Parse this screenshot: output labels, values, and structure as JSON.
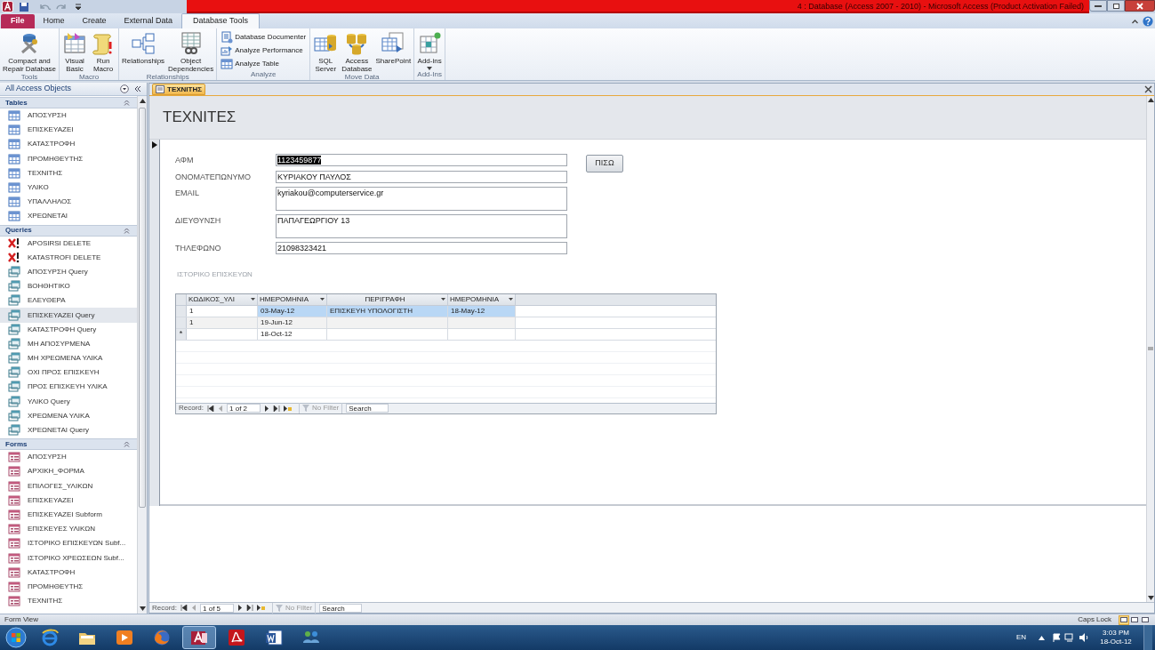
{
  "window": {
    "title": "4 : Database (Access 2007 - 2010)  -  Microsoft Access (Product Activation Failed)"
  },
  "ribbon_tabs": [
    {
      "label": "File",
      "kind": "file",
      "selected": false
    },
    {
      "label": "Home",
      "kind": "tab",
      "selected": false
    },
    {
      "label": "Create",
      "kind": "tab",
      "selected": false
    },
    {
      "label": "External Data",
      "kind": "tab",
      "selected": false
    },
    {
      "label": "Database Tools",
      "kind": "tab",
      "selected": true
    }
  ],
  "ribbon_groups": [
    {
      "label": "Tools",
      "buttons": [
        {
          "label": "Compact and\nRepair Database",
          "kind": "large"
        }
      ]
    },
    {
      "label": "Macro",
      "buttons": [
        {
          "label": "Visual\nBasic",
          "kind": "large"
        },
        {
          "label": "Run\nMacro",
          "kind": "large"
        }
      ]
    },
    {
      "label": "Relationships",
      "buttons": [
        {
          "label": "Relationships",
          "kind": "large"
        },
        {
          "label": "Object\nDependencies",
          "kind": "large"
        }
      ]
    },
    {
      "label": "Analyze",
      "buttons": [
        {
          "label": "Database Documenter",
          "kind": "small"
        },
        {
          "label": "Analyze Performance",
          "kind": "small"
        },
        {
          "label": "Analyze Table",
          "kind": "small"
        }
      ]
    },
    {
      "label": "Move Data",
      "buttons": [
        {
          "label": "SQL\nServer",
          "kind": "large"
        },
        {
          "label": "Access\nDatabase",
          "kind": "large"
        },
        {
          "label": "SharePoint",
          "kind": "large"
        }
      ]
    },
    {
      "label": "Add-Ins",
      "buttons": [
        {
          "label": "Add-ins",
          "kind": "dropdown"
        }
      ]
    }
  ],
  "navigation": {
    "header": "All Access Objects",
    "groups": [
      {
        "label": "Tables",
        "items": [
          {
            "label": "ΑΠΟΣΥΡΣΗ",
            "kind": "table",
            "selected": false
          },
          {
            "label": "ΕΠΙΣΚΕΥΑΖΕΙ",
            "kind": "table",
            "selected": false
          },
          {
            "label": "ΚΑΤΑΣΤΡΟΦΗ",
            "kind": "table",
            "selected": false
          },
          {
            "label": "ΠΡΟΜΗΘΕΥΤΗΣ",
            "kind": "table",
            "selected": false
          },
          {
            "label": "ΤΕΧΝΙΤΗΣ",
            "kind": "table",
            "selected": false
          },
          {
            "label": "ΥΛΙΚΟ",
            "kind": "table",
            "selected": false
          },
          {
            "label": "ΥΠΑΛΛΗΛΟΣ",
            "kind": "table",
            "selected": false
          },
          {
            "label": "ΧΡΕΩΝΕΤΑΙ",
            "kind": "table",
            "selected": false
          }
        ]
      },
      {
        "label": "Queries",
        "items": [
          {
            "label": "APOSIRSI DELETE",
            "kind": "delete_query",
            "selected": false
          },
          {
            "label": "KATASTROFI DELETE",
            "kind": "delete_query",
            "selected": false
          },
          {
            "label": "ΑΠΟΣΥΡΣΗ Query",
            "kind": "query",
            "selected": false
          },
          {
            "label": "ΒΟΗΘΗΤΙΚΟ",
            "kind": "query",
            "selected": false
          },
          {
            "label": "ΕΛΕΥΘΕΡΑ",
            "kind": "query",
            "selected": false
          },
          {
            "label": "ΕΠΙΣΚΕΥΑΖΕΙ Query",
            "kind": "query",
            "selected": true
          },
          {
            "label": "ΚΑΤΑΣΤΡΟΦΗ Query",
            "kind": "query",
            "selected": false
          },
          {
            "label": "ΜΗ ΑΠΟΣΥΡΜΕΝΑ",
            "kind": "query",
            "selected": false
          },
          {
            "label": "ΜΗ ΧΡΕΩΜΕΝΑ ΥΛΙΚΑ",
            "kind": "query",
            "selected": false
          },
          {
            "label": "ΟΧΙ ΠΡΟΣ ΕΠΙΣΚΕΥΗ",
            "kind": "query",
            "selected": false
          },
          {
            "label": "ΠΡΟΣ ΕΠΙΣΚΕΥΗ ΥΛΙΚΑ",
            "kind": "query",
            "selected": false
          },
          {
            "label": "ΥΛΙΚΟ Query",
            "kind": "query",
            "selected": false
          },
          {
            "label": "ΧΡΕΩΜΕΝΑ ΥΛΙΚΑ",
            "kind": "query",
            "selected": false
          },
          {
            "label": "ΧΡΕΩΝΕΤΑΙ Query",
            "kind": "query",
            "selected": false
          }
        ]
      },
      {
        "label": "Forms",
        "items": [
          {
            "label": "ΑΠΟΣΥΡΣΗ",
            "kind": "form",
            "selected": false
          },
          {
            "label": "ΑΡΧΙΚΗ_ΦΟΡΜΑ",
            "kind": "form",
            "selected": false
          },
          {
            "label": "ΕΠΙΛΟΓΕΣ_ΥΛΙΚΩΝ",
            "kind": "form",
            "selected": false
          },
          {
            "label": "ΕΠΙΣΚΕΥΑΖΕΙ",
            "kind": "form",
            "selected": false
          },
          {
            "label": "ΕΠΙΣΚΕΥΑΖΕΙ Subform",
            "kind": "form",
            "selected": false
          },
          {
            "label": "ΕΠΙΣΚΕΥΕΣ ΥΛΙΚΩΝ",
            "kind": "form",
            "selected": false
          },
          {
            "label": "ΙΣΤΟΡΙΚΟ ΕΠΙΣΚΕΥΩΝ Subf...",
            "kind": "form",
            "selected": false
          },
          {
            "label": "ΙΣΤΟΡΙΚΟ ΧΡΕΩΣΕΩΝ Subf...",
            "kind": "form",
            "selected": false
          },
          {
            "label": "ΚΑΤΑΣΤΡΟΦΗ",
            "kind": "form",
            "selected": false
          },
          {
            "label": "ΠΡΟΜΗΘΕΥΤΗΣ",
            "kind": "form",
            "selected": false
          },
          {
            "label": "ΤΕΧΝΙΤΗΣ",
            "kind": "form",
            "selected": false
          }
        ]
      }
    ]
  },
  "document_tabs": [
    {
      "label": "ΤΕΧΝΙΤΗΣ",
      "selected": true
    }
  ],
  "form": {
    "title": "ΤΕΧΝΙΤΕΣ",
    "fields": [
      {
        "label": "ΑΦΜ",
        "value": "1123459877",
        "kind": "single",
        "highlighted": true
      },
      {
        "label": "ΟΝΟΜΑΤΕΠΩΝΥΜΟ",
        "value": "ΚΥΡΙΑΚΟΥ ΠΑΥΛΟΣ",
        "kind": "single",
        "highlighted": false
      },
      {
        "label": "EMAIL",
        "value": "kyriakou@computerservice.gr",
        "kind": "multiline",
        "highlighted": false
      },
      {
        "label": "ΔΙΕΥΘΥΝΣΗ",
        "value": "ΠΑΠΑΓΕΩΡΓΙΟΥ 13",
        "kind": "multiline",
        "highlighted": false
      },
      {
        "label": "ΤΗΛΕΦΩΝΟ",
        "value": "21098323421",
        "kind": "single",
        "highlighted": false
      }
    ],
    "back_button": "ΠΙΣΩ",
    "subform": {
      "label": "ΙΣΤΟΡΙΚΟ ΕΠΙΣΚΕΥΩΝ",
      "columns": [
        "ΚΩΔΙΚΟΣ_ΥΛΙ",
        "ΗΜΕΡΟΜΗΝΙΑ",
        "ΠΕΡΙΓΡΑΦΗ",
        "ΗΜΕΡΟΜΗΝΙΑ"
      ],
      "rows": [
        {
          "kind": "record",
          "selected": true,
          "cells": [
            "1",
            "03-May-12",
            "ΕΠΙΣΚΕΥΗ ΥΠΟΛΟΓΙΣΤΗ",
            "18-May-12"
          ]
        },
        {
          "kind": "record",
          "selected": false,
          "cells": [
            "1",
            "19-Jun-12",
            "",
            ""
          ]
        },
        {
          "kind": "new",
          "marker": "*",
          "selected": false,
          "cells": [
            "",
            "18-Oct-12",
            "",
            ""
          ]
        }
      ],
      "record_nav": {
        "label": "Record:",
        "position": "1 of 2",
        "filter": "No Filter",
        "search": "Search"
      }
    },
    "record_nav": {
      "label": "Record:",
      "position": "1 of 5",
      "filter": "No Filter",
      "search": "Search"
    }
  },
  "status_bar": {
    "view": "Form View",
    "caps_lock": "Caps Lock",
    "views": [
      {
        "selected": true
      },
      {
        "selected": false
      },
      {
        "selected": false
      }
    ]
  },
  "taskbar": {
    "apps": [
      {
        "active": false
      },
      {
        "active": false
      },
      {
        "active": false
      },
      {
        "active": false
      },
      {
        "active": true
      },
      {
        "active": false
      },
      {
        "active": false
      },
      {
        "active": false
      }
    ],
    "tray": {
      "language": "EN",
      "time": "3:03 PM",
      "date": "18-Oct-12"
    }
  }
}
